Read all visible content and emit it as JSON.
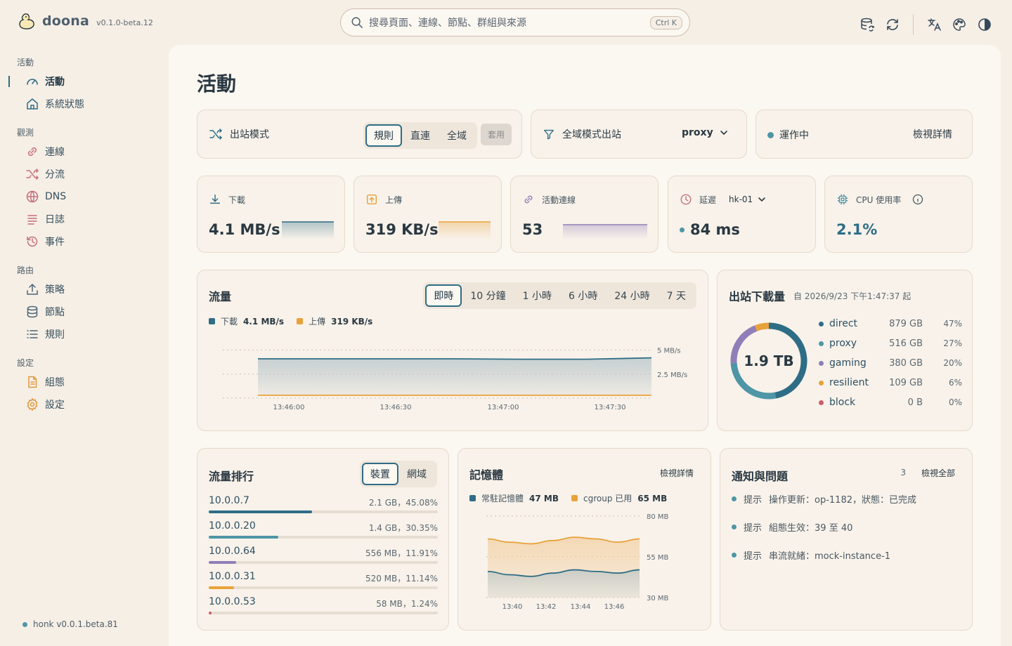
{
  "app": {
    "name": "doona",
    "version": "v0.1.0-beta.12",
    "core_version": "honk v0.0.1.beta.81"
  },
  "search": {
    "placeholder": "搜尋頁面、連線、節點、群組與來源",
    "shortcut": "Ctrl K"
  },
  "top_icons": [
    "database-sync-icon",
    "refresh-icon",
    "translate-icon",
    "palette-icon",
    "contrast-icon"
  ],
  "sidebar": {
    "groups": [
      {
        "label": "活動",
        "items": [
          {
            "label": "活動",
            "icon": "gauge-icon",
            "active": true
          },
          {
            "label": "系統狀態",
            "icon": "home-icon"
          }
        ]
      },
      {
        "label": "觀測",
        "items": [
          {
            "label": "連線",
            "icon": "link-icon"
          },
          {
            "label": "分流",
            "icon": "shuffle-icon"
          },
          {
            "label": "DNS",
            "icon": "globe-icon"
          },
          {
            "label": "日誌",
            "icon": "log-icon"
          },
          {
            "label": "事件",
            "icon": "history-icon"
          }
        ]
      },
      {
        "label": "路由",
        "items": [
          {
            "label": "策略",
            "icon": "upload-icon"
          },
          {
            "label": "節點",
            "icon": "database-icon"
          },
          {
            "label": "規則",
            "icon": "list-icon"
          }
        ]
      },
      {
        "label": "設定",
        "items": [
          {
            "label": "組態",
            "icon": "file-icon"
          },
          {
            "label": "設定",
            "icon": "gear-icon"
          }
        ]
      }
    ]
  },
  "page": {
    "title": "活動"
  },
  "mode_card": {
    "label": "出站模式",
    "options": [
      "規則",
      "直連",
      "全域"
    ],
    "selected": "規則",
    "apply": "套用"
  },
  "global_card": {
    "label": "全域模式出站",
    "value": "proxy"
  },
  "status_card": {
    "status": "運作中",
    "link": "檢視詳情",
    "status_color": "#4e95a6"
  },
  "stats": {
    "download": {
      "label": "下載",
      "value": "4.1 MB/s",
      "color": "#2e6d86"
    },
    "upload": {
      "label": "上傳",
      "value": "319 KB/s",
      "color": "#e8a23a"
    },
    "connections": {
      "label": "活動連線",
      "value": "53",
      "color": "#8f7fb8"
    },
    "latency": {
      "label": "延遲",
      "node": "hk-01",
      "value": "84 ms",
      "color": "#4e95a6"
    },
    "cpu": {
      "label": "CPU 使用率",
      "value": "2.1%"
    }
  },
  "traffic": {
    "title": "流量",
    "ranges": [
      "即時",
      "10 分鐘",
      "1 小時",
      "6 小時",
      "24 小時",
      "7 天"
    ],
    "selected": "即時",
    "legend": [
      {
        "name": "下載",
        "value": "4.1 MB/s",
        "color": "#2e6d86"
      },
      {
        "name": "上傳",
        "value": "319 KB/s",
        "color": "#e8a23a"
      }
    ]
  },
  "outbound": {
    "title": "出站下載量",
    "since": "自 2026/9/23 下午1:47:37 起",
    "total": "1.9 TB"
  },
  "ranking": {
    "title": "流量排行",
    "tabs": [
      "裝置",
      "網域"
    ],
    "selected": "裝置",
    "rows": [
      {
        "ip": "10.0.0.7",
        "value": "2.1 GB，45.08%",
        "fraction": 0.4508,
        "color": "#2e6d86"
      },
      {
        "ip": "10.0.0.20",
        "value": "1.4 GB，30.35%",
        "fraction": 0.3035,
        "color": "#4e95a6"
      },
      {
        "ip": "10.0.0.64",
        "value": "556 MB，11.91%",
        "fraction": 0.1191,
        "color": "#8f7fb8"
      },
      {
        "ip": "10.0.0.31",
        "value": "520 MB，11.14%",
        "fraction": 0.1114,
        "color": "#e8a23a"
      },
      {
        "ip": "10.0.0.53",
        "value": "58 MB，1.24%",
        "fraction": 0.0124,
        "color": "#c95f6a"
      }
    ]
  },
  "memory": {
    "title": "記憶體",
    "link": "檢視詳情",
    "legend": [
      {
        "name": "常駐記憶體",
        "value": "47 MB",
        "color": "#2e6d86"
      },
      {
        "name": "cgroup 已用",
        "value": "65 MB",
        "color": "#e8a23a"
      }
    ]
  },
  "notifications": {
    "title": "通知與問題",
    "count": "3",
    "link": "檢視全部",
    "items": [
      {
        "tag": "提示",
        "msg": "操作更新：op-1182，狀態：已完成"
      },
      {
        "tag": "提示",
        "msg": "組態生效：39 至 40"
      },
      {
        "tag": "提示",
        "msg": "串流就緒：mock-instance-1"
      }
    ]
  },
  "chart_data": [
    {
      "type": "area",
      "x": [
        "13:45:45",
        "13:45:52",
        "13:46:00",
        "13:46:30",
        "13:47:00",
        "13:47:30",
        "13:47:37"
      ],
      "xticks": [
        "13:46:00",
        "13:46:30",
        "13:47:00",
        "13:47:30"
      ],
      "yticks": [
        "5 MB/s",
        "2.5 MB/s"
      ],
      "ylim": [
        0,
        6
      ],
      "series": [
        {
          "name": "下載",
          "values": [
            4.1,
            4.1,
            4.1,
            4.1,
            4.05,
            4.05,
            4.2
          ]
        },
        {
          "name": "上傳",
          "values": [
            0.3,
            0.3,
            0.3,
            0.3,
            0.3,
            0.3,
            0.3
          ]
        }
      ]
    },
    {
      "type": "pie",
      "labels": [
        "direct",
        "proxy",
        "gaming",
        "resilient",
        "block"
      ],
      "values_text": [
        "879 GB",
        "516 GB",
        "380 GB",
        "109 GB",
        "0 B"
      ],
      "percents_text": [
        "47%",
        "27%",
        "20%",
        "6%",
        "0%"
      ],
      "values": [
        47,
        27,
        20,
        6,
        0
      ],
      "colors": [
        "#2e6d86",
        "#4e95a6",
        "#8f7fb8",
        "#e8a23a",
        "#c95f6a"
      ]
    },
    {
      "type": "area",
      "xticks": [
        "13:40",
        "13:42",
        "13:44",
        "13:46"
      ],
      "yticks": [
        "80 MB",
        "55 MB",
        "30 MB"
      ],
      "ylim": [
        30,
        80
      ],
      "series": [
        {
          "name": "常駐記憶體",
          "values": [
            46,
            44,
            43,
            45,
            47,
            46,
            45,
            47
          ]
        },
        {
          "name": "cgroup 已用",
          "values": [
            66,
            64,
            63,
            65,
            67,
            66,
            64,
            66
          ]
        }
      ]
    }
  ]
}
